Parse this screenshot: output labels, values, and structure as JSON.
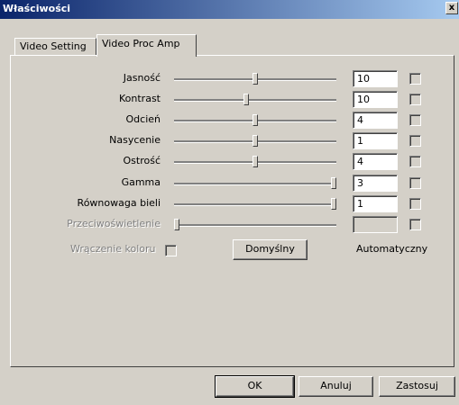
{
  "window": {
    "title": "Właściwości",
    "close_glyph": "x"
  },
  "tabs": [
    {
      "label": "Video Setting"
    },
    {
      "label": "Video Proc Amp"
    }
  ],
  "rows": [
    {
      "label": "Jasność",
      "value": "10",
      "level": 0.5,
      "enabled": true
    },
    {
      "label": "Kontrast",
      "value": "10",
      "level": 0.44,
      "enabled": true
    },
    {
      "label": "Odcień",
      "value": "4",
      "level": 0.5,
      "enabled": true
    },
    {
      "label": "Nasycenie",
      "value": "1",
      "level": 0.5,
      "enabled": true
    },
    {
      "label": "Ostrość",
      "value": "4",
      "level": 0.5,
      "enabled": true
    },
    {
      "label": "Gamma",
      "value": "3",
      "level": 1.0,
      "enabled": true
    },
    {
      "label": "Równowaga bieli",
      "value": "1",
      "level": 1.0,
      "enabled": true
    },
    {
      "label": "Przeciwoświetlenie",
      "value": "",
      "level": 0.0,
      "enabled": false
    }
  ],
  "color_enable": {
    "label": "Wrączenie koloru"
  },
  "default_button": {
    "label": "Domyślny"
  },
  "auto_label": "Automatyczny",
  "footer": {
    "ok": "OK",
    "cancel": "Anuluj",
    "apply": "Zastosuj"
  }
}
